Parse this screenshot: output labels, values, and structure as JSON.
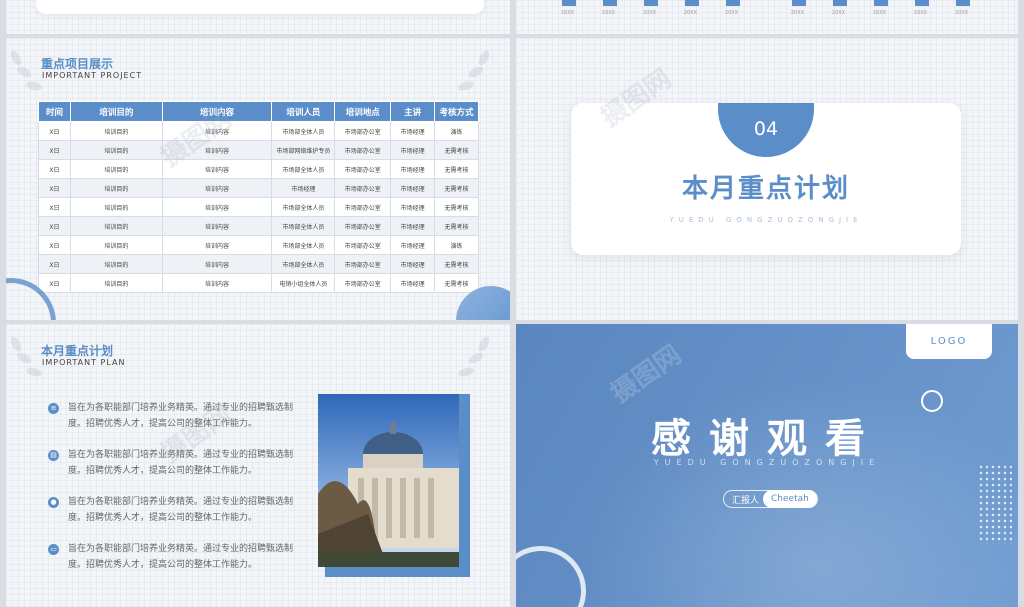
{
  "top_strip": {
    "chart_labels_left": [
      "20XX",
      "20XX",
      "20XX",
      "20XX",
      "20XX"
    ],
    "chart_labels_right": [
      "20XX",
      "20XX",
      "20XX",
      "20XX",
      "20XX"
    ]
  },
  "table_slide": {
    "title": "重点项目展示",
    "subtitle": "IMPORTANT PROJECT",
    "columns": [
      "时间",
      "培训目的",
      "培训内容",
      "培训人员",
      "培训地点",
      "主讲",
      "考核方式"
    ],
    "rows": [
      [
        "X日",
        "培训目的",
        "培训内容",
        "市场部全体人员",
        "市场部办公室",
        "市场经理",
        "演练"
      ],
      [
        "X日",
        "培训目的",
        "培训内容",
        "市场部网络维护专员",
        "市场部办公室",
        "市场经理",
        "无需考核"
      ],
      [
        "X日",
        "培训目的",
        "培训内容",
        "市场部全体人员",
        "市场部办公室",
        "市场经理",
        "无需考核"
      ],
      [
        "X日",
        "培训目的",
        "培训内容",
        "市场经理",
        "市场部办公室",
        "市场经理",
        "无需考核"
      ],
      [
        "X日",
        "培训目的",
        "培训内容",
        "市场部全体人员",
        "市场部办公室",
        "市场经理",
        "无需考核"
      ],
      [
        "X日",
        "培训目的",
        "培训内容",
        "市场部全体人员",
        "市场部办公室",
        "市场经理",
        "无需考核"
      ],
      [
        "X日",
        "培训目的",
        "培训内容",
        "市场部全体人员",
        "市场部办公室",
        "市场经理",
        "演练"
      ],
      [
        "X日",
        "培训目的",
        "培训内容",
        "市场部全体人员",
        "市场部办公室",
        "市场经理",
        "无需考核"
      ],
      [
        "X日",
        "培训目的",
        "培训内容",
        "电销小组全体人员",
        "市场部办公室",
        "市场经理",
        "无需考核"
      ]
    ]
  },
  "section_slide": {
    "number": "04",
    "title": "本月重点计划",
    "subtitle": "YUEDU GONGZUOZONGJIE"
  },
  "list_slide": {
    "title": "本月重点计划",
    "subtitle": "IMPORTANT PLAN",
    "items": [
      {
        "icon": "list-icon",
        "text": "旨在为各职能部门培养业务精英。通过专业的招聘甄选制度。招聘优秀人才，提高公司的整体工作能力。"
      },
      {
        "icon": "document-icon",
        "text": "旨在为各职能部门培养业务精英。通过专业的招聘甄选制度。招聘优秀人才，提高公司的整体工作能力。"
      },
      {
        "icon": "location-icon",
        "text": "旨在为各职能部门培养业务精英。通过专业的招聘甄选制度。招聘优秀人才，提高公司的整体工作能力。"
      },
      {
        "icon": "monitor-icon",
        "text": "旨在为各职能部门培养业务精英。通过专业的招聘甄选制度。招聘优秀人才，提高公司的整体工作能力。"
      }
    ]
  },
  "thanks_slide": {
    "logo": "LOGO",
    "title": "感谢观看",
    "subtitle": "YUEDU GONGZUOZONGJIE",
    "reporter_label": "汇报人",
    "reporter_name": "Cheetah"
  },
  "colors": {
    "accent": "#5b8ec9",
    "background": "#f3f5f8",
    "thanks_bg": "#6b98cf"
  }
}
